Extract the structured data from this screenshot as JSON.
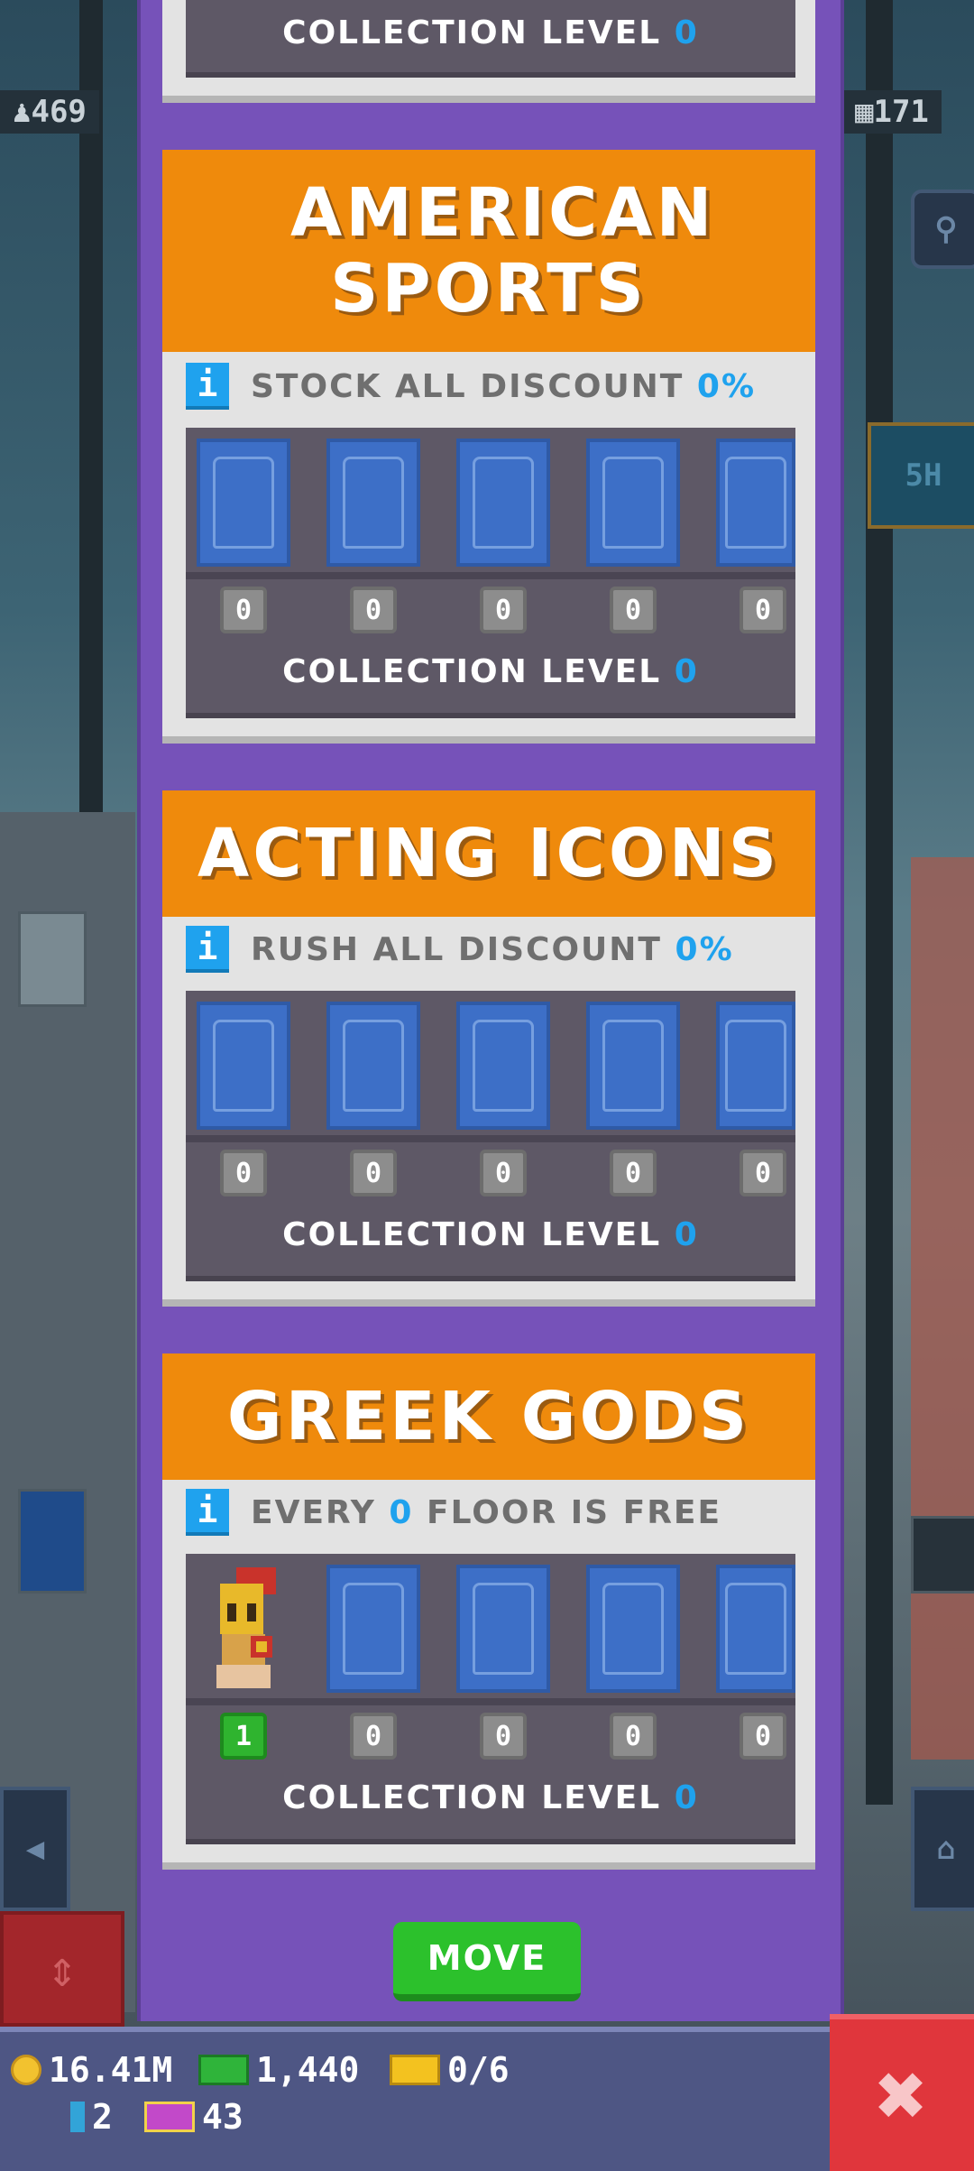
{
  "hud": {
    "population": "469",
    "floors": "171",
    "time_badge": "5H"
  },
  "cards": [
    {
      "title": "",
      "collection_label": "COLLECTION LEVEL",
      "collection_level": "0"
    },
    {
      "title": "AMERICAN SPORTS",
      "bonus_prefix": "STOCK ALL DISCOUNT",
      "bonus_value": "0%",
      "bonus_suffix": "",
      "counts": [
        "0",
        "0",
        "0",
        "0",
        "0"
      ],
      "collection_label": "COLLECTION LEVEL",
      "collection_level": "0"
    },
    {
      "title": "ACTING ICONS",
      "bonus_prefix": "RUSH ALL DISCOUNT",
      "bonus_value": "0%",
      "bonus_suffix": "",
      "counts": [
        "0",
        "0",
        "0",
        "0",
        "0"
      ],
      "collection_label": "COLLECTION LEVEL",
      "collection_level": "0"
    },
    {
      "title": "GREEK GODS",
      "bonus_prefix": "EVERY",
      "bonus_value": "0",
      "bonus_suffix": "FLOOR IS FREE",
      "counts": [
        "1",
        "0",
        "0",
        "0",
        "0"
      ],
      "collection_label": "COLLECTION LEVEL",
      "collection_level": "0"
    }
  ],
  "move_button": "MOVE",
  "currency": {
    "coins": "16.41M",
    "bux": "1,440",
    "tickets": "0/6",
    "gems": "2",
    "vip": "43"
  },
  "colors": {
    "panel": "#7652b9",
    "card_header": "#ef8a0c",
    "accent_blue": "#1fa2ee",
    "move_green": "#2cc12c",
    "close_red": "#e0363c"
  },
  "icons": {
    "info": "info-icon",
    "close": "close-icon",
    "coin": "coin-icon",
    "bux": "bux-icon",
    "ticket": "golden-ticket-icon",
    "vip": "vip-icon",
    "elevator": "elevator-icon"
  }
}
